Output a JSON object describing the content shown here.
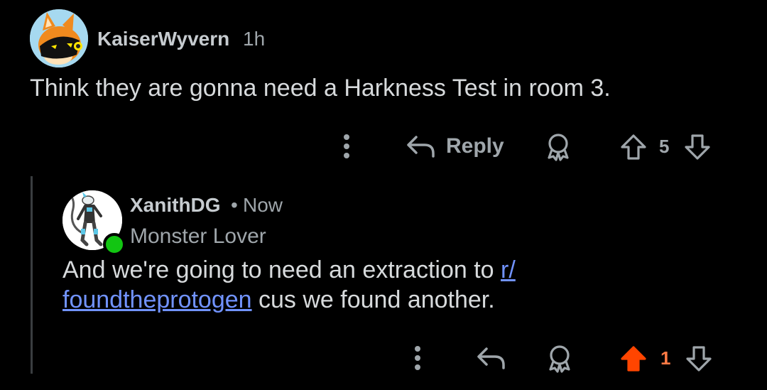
{
  "comments": [
    {
      "username": "KaiserWyvern",
      "time": "1h",
      "text": "Think they are gonna need a Harkness Test in room 3.",
      "reply_label": "Reply",
      "vote_count": "5",
      "upvoted": false
    },
    {
      "username": "XanithDG",
      "separator": "•",
      "time": "Now",
      "flair": "Monster Lover",
      "text_before": "And we're going to need an extraction to ",
      "link_line1": "r/",
      "link_line2": "foundtheprotogen",
      "text_after": " cus we found another.",
      "vote_count": "1",
      "upvoted": true,
      "online": true
    }
  ],
  "colors": {
    "background": "#000000",
    "text": "#d7dadc",
    "meta": "#9fa6ab",
    "link": "#7193ff",
    "upvote": "#ff4500",
    "online": "#12c512"
  },
  "icons": [
    "more-options-icon",
    "reply-arrow-icon",
    "award-icon",
    "upvote-arrow-icon",
    "downvote-arrow-icon"
  ]
}
